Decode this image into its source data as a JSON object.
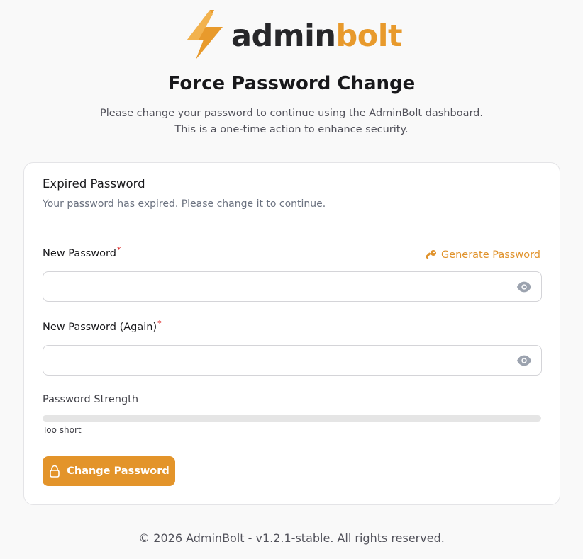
{
  "brand": {
    "part1": "admin",
    "part2": "bolt",
    "accent_color": "#e89a2c",
    "dark_color": "#27272a",
    "logo_icon": "lightning-bolt-icon"
  },
  "header": {
    "title": "Force Password Change",
    "subtitle_line1": "Please change your password to continue using the AdminBolt dashboard.",
    "subtitle_line2": "This is a one-time action to enhance security."
  },
  "card": {
    "heading": "Expired Password",
    "description": "Your password has expired. Please change it to continue."
  },
  "form": {
    "new_password": {
      "label": "New Password",
      "required_mark": "*",
      "value": "",
      "placeholder": "",
      "toggle_icon": "eye-icon"
    },
    "generate_password": {
      "label": "Generate Password",
      "icon": "key-icon"
    },
    "new_password_again": {
      "label": "New Password (Again)",
      "required_mark": "*",
      "value": "",
      "placeholder": "",
      "toggle_icon": "eye-icon"
    },
    "strength": {
      "label": "Password Strength",
      "status": "Too short",
      "level": 0
    },
    "submit": {
      "label": "Change Password",
      "icon": "lock-icon",
      "color": "#e3942a"
    }
  },
  "footer": {
    "text": "© 2026 AdminBolt - v1.2.1-stable. All rights reserved."
  }
}
